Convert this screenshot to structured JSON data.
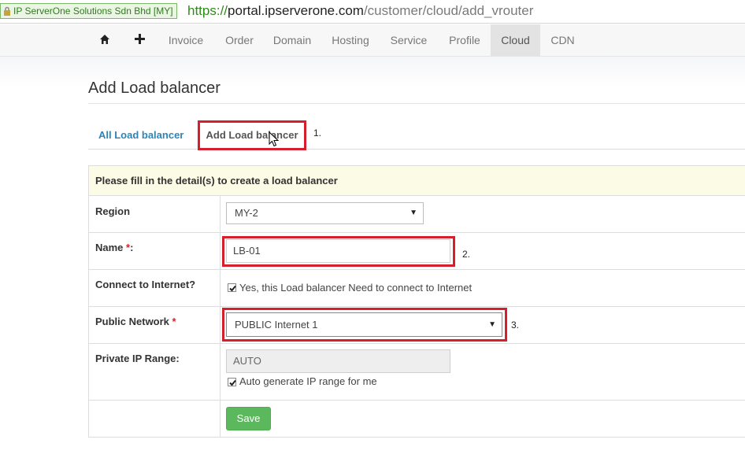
{
  "address_bar": {
    "cert_label": "IP ServerOne Solutions Sdn Bhd [MY]",
    "url_scheme": "https://",
    "url_host": "portal.ipserverone.com",
    "url_path": "/customer/cloud/add_vrouter"
  },
  "nav": {
    "items": [
      {
        "label": "Invoice"
      },
      {
        "label": "Order"
      },
      {
        "label": "Domain"
      },
      {
        "label": "Hosting"
      },
      {
        "label": "Service"
      },
      {
        "label": "Profile"
      },
      {
        "label": "Cloud",
        "active": true
      },
      {
        "label": "CDN"
      }
    ]
  },
  "page": {
    "title": "Add Load balancer"
  },
  "tabs": {
    "all_label": "All Load balancer",
    "add_label": "Add Load balancer"
  },
  "annotations": {
    "step1": "1.",
    "step2": "2.",
    "step3": "3."
  },
  "form": {
    "header": "Please fill in the detail(s) to create a load balancer",
    "region_label": "Region",
    "region_value": "MY-2",
    "name_label": "Name",
    "name_value": "LB-01",
    "required_mark": "*",
    "name_colon": ":",
    "connect_label": "Connect to Internet?",
    "connect_checkbox_label": "Yes, this Load balancer Need to connect to Internet",
    "connect_checked": true,
    "public_network_label": "Public Network",
    "public_network_value": "PUBLIC Internet 1",
    "private_ip_label": "Private IP Range:",
    "private_ip_value": "AUTO",
    "auto_checkbox_label": "Auto generate IP range for me",
    "auto_checked": true,
    "save_label": "Save"
  },
  "colors": {
    "accent_link": "#2f84b6",
    "highlight_red": "#d51f2c",
    "save_green": "#5cb85c",
    "header_yellow": "#fcfbe6"
  }
}
